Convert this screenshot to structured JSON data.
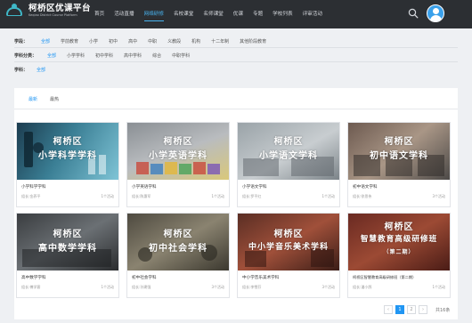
{
  "header": {
    "brand_title": "柯桥区优课平台",
    "brand_subtitle": "Keqiao District Course Platform",
    "nav": [
      {
        "label": "首页",
        "active": false
      },
      {
        "label": "活动直播",
        "active": false
      },
      {
        "label": "网络研修",
        "active": true
      },
      {
        "label": "名校课堂",
        "active": false
      },
      {
        "label": "名师课堂",
        "active": false
      },
      {
        "label": "优课",
        "active": false
      },
      {
        "label": "专题",
        "active": false
      },
      {
        "label": "学校列表",
        "active": false
      },
      {
        "label": "评审活动",
        "active": false
      }
    ],
    "icons": {
      "search": "search-icon",
      "user": "user-avatar-icon"
    }
  },
  "filters": {
    "stage": {
      "label": "学段：",
      "options": [
        "全部",
        "学前教育",
        "小学",
        "初中",
        "高中",
        "中职",
        "义教段",
        "机构",
        "十二年制",
        "其他阶段教育"
      ],
      "selected": "全部"
    },
    "subject": {
      "label": "学科分类：",
      "options": [
        "全部",
        "小学学科",
        "初中学科",
        "高中学科",
        "综合",
        "中职学科"
      ],
      "selected": "全部"
    },
    "discipline": {
      "label": "学科：",
      "options": [
        "全部"
      ],
      "selected": "全部"
    }
  },
  "tabs": [
    {
      "label": "最新",
      "active": true
    },
    {
      "label": "最热",
      "active": false
    }
  ],
  "cards": [
    {
      "thumb_line1": "柯桥区",
      "thumb_line2": "小学科学学科",
      "title": "小学科学学科",
      "meta": "组长:金养平",
      "count": "1个活动"
    },
    {
      "thumb_line1": "柯桥区",
      "thumb_line2": "小学英语学科",
      "title": "小学英语学科",
      "meta": "组长:陈惠军",
      "count": "1个活动"
    },
    {
      "thumb_line1": "柯桥区",
      "thumb_line2": "小学语文学科",
      "title": "小学语文学科",
      "meta": "组长:罗平红",
      "count": "1个活动"
    },
    {
      "thumb_line1": "柯桥区",
      "thumb_line2": "初中语文学科",
      "title": "初中语文学科",
      "meta": "组长:徐思伟",
      "count": "3个活动"
    },
    {
      "thumb_line1": "柯桥区",
      "thumb_line2": "高中数学学科",
      "title": "高中数学学科",
      "meta": "组长:傅学客",
      "count": "1个活动"
    },
    {
      "thumb_line1": "柯桥区",
      "thumb_line2": "初中社会学科",
      "title": "初中社会学科",
      "meta": "组长:孙建强",
      "count": "3个活动"
    },
    {
      "thumb_line1": "柯桥区",
      "thumb_line2": "中小学音乐美术学科",
      "title": "中小学音乐美术学科",
      "meta": "组长:李雪芬",
      "count": "3个活动"
    },
    {
      "thumb_line1": "柯桥区",
      "thumb_line2": "智慧教育高级研修班",
      "thumb_line3": "（第二期）",
      "title": "柯桥区智慧教育高级研修班（第二期）",
      "meta": "组长:潘小鸽",
      "count": "1个活动"
    }
  ],
  "pagination": {
    "prev": "‹",
    "pages": [
      "1",
      "2"
    ],
    "current": "1",
    "next": "›",
    "total": "共16条"
  }
}
